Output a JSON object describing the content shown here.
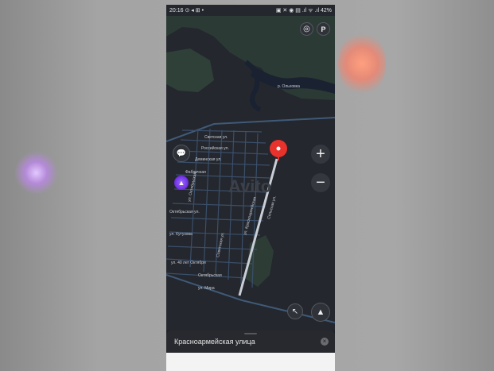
{
  "status_bar": {
    "time": "20:16",
    "left_icons": "⊙ ◂ ⊞ •",
    "right_icons": "▣ ✕ ◉ ▤ .ıl ᯤ .ıl",
    "battery": "42%"
  },
  "map": {
    "water_label": "р. Ольховка",
    "street_labels": [
      "Светская ул.",
      "Российская ул.",
      "Деминская ул.",
      "Фабричная",
      "Октябрьская ул.",
      "ул. Октябрьская",
      "ул. Кутузова",
      "ул. 40 лет Октября",
      "Октябрьская",
      "Советская ул.",
      "Сельская ул.",
      "ул. Красноармейская",
      "ул. Мира"
    ],
    "watermark": "Avito",
    "pin_color": "#e8322c",
    "route_color": "#c9ced6"
  },
  "controls": {
    "zoom_in": "+",
    "zoom_out": "−",
    "layers_icon": "layers-icon",
    "parking_label": "P",
    "compass_icon": "compass-icon",
    "navigator_icon": "navigation-arrow-icon",
    "messages_icon": "chat-bubble-icon",
    "assistant_icon": "alice-assistant-icon"
  },
  "bottom_sheet": {
    "address": "Красноармейская улица",
    "close": "×"
  }
}
